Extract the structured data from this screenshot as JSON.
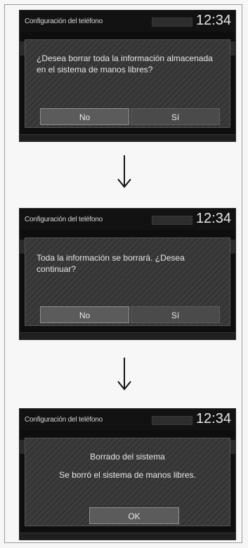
{
  "screens": [
    {
      "title": "Configuración del teléfono",
      "time": "12:34",
      "dialog_text": "¿Desea borrar toda la información almacenada en el sistema de manos libres?",
      "buttons": {
        "no": "No",
        "yes": "Sí"
      }
    },
    {
      "title": "Configuración del teléfono",
      "time": "12:34",
      "dialog_text": "Toda la información se borrará. ¿Desea continuar?",
      "buttons": {
        "no": "No",
        "yes": "Sí"
      }
    },
    {
      "title": "Configuración del teléfono",
      "time": "12:34",
      "dialog_title": "Borrado del sistema",
      "dialog_text": "Se borró el sistema de manos libres.",
      "buttons": {
        "ok": "OK"
      }
    }
  ],
  "icons": {
    "flow_arrow": "arrow-down-icon"
  },
  "colors": {
    "screen_bg": "#0e0e0e",
    "dialog_bg": "#3a3a3a",
    "selected_button": "#5b5b5b",
    "text": "#e8e8e8"
  }
}
